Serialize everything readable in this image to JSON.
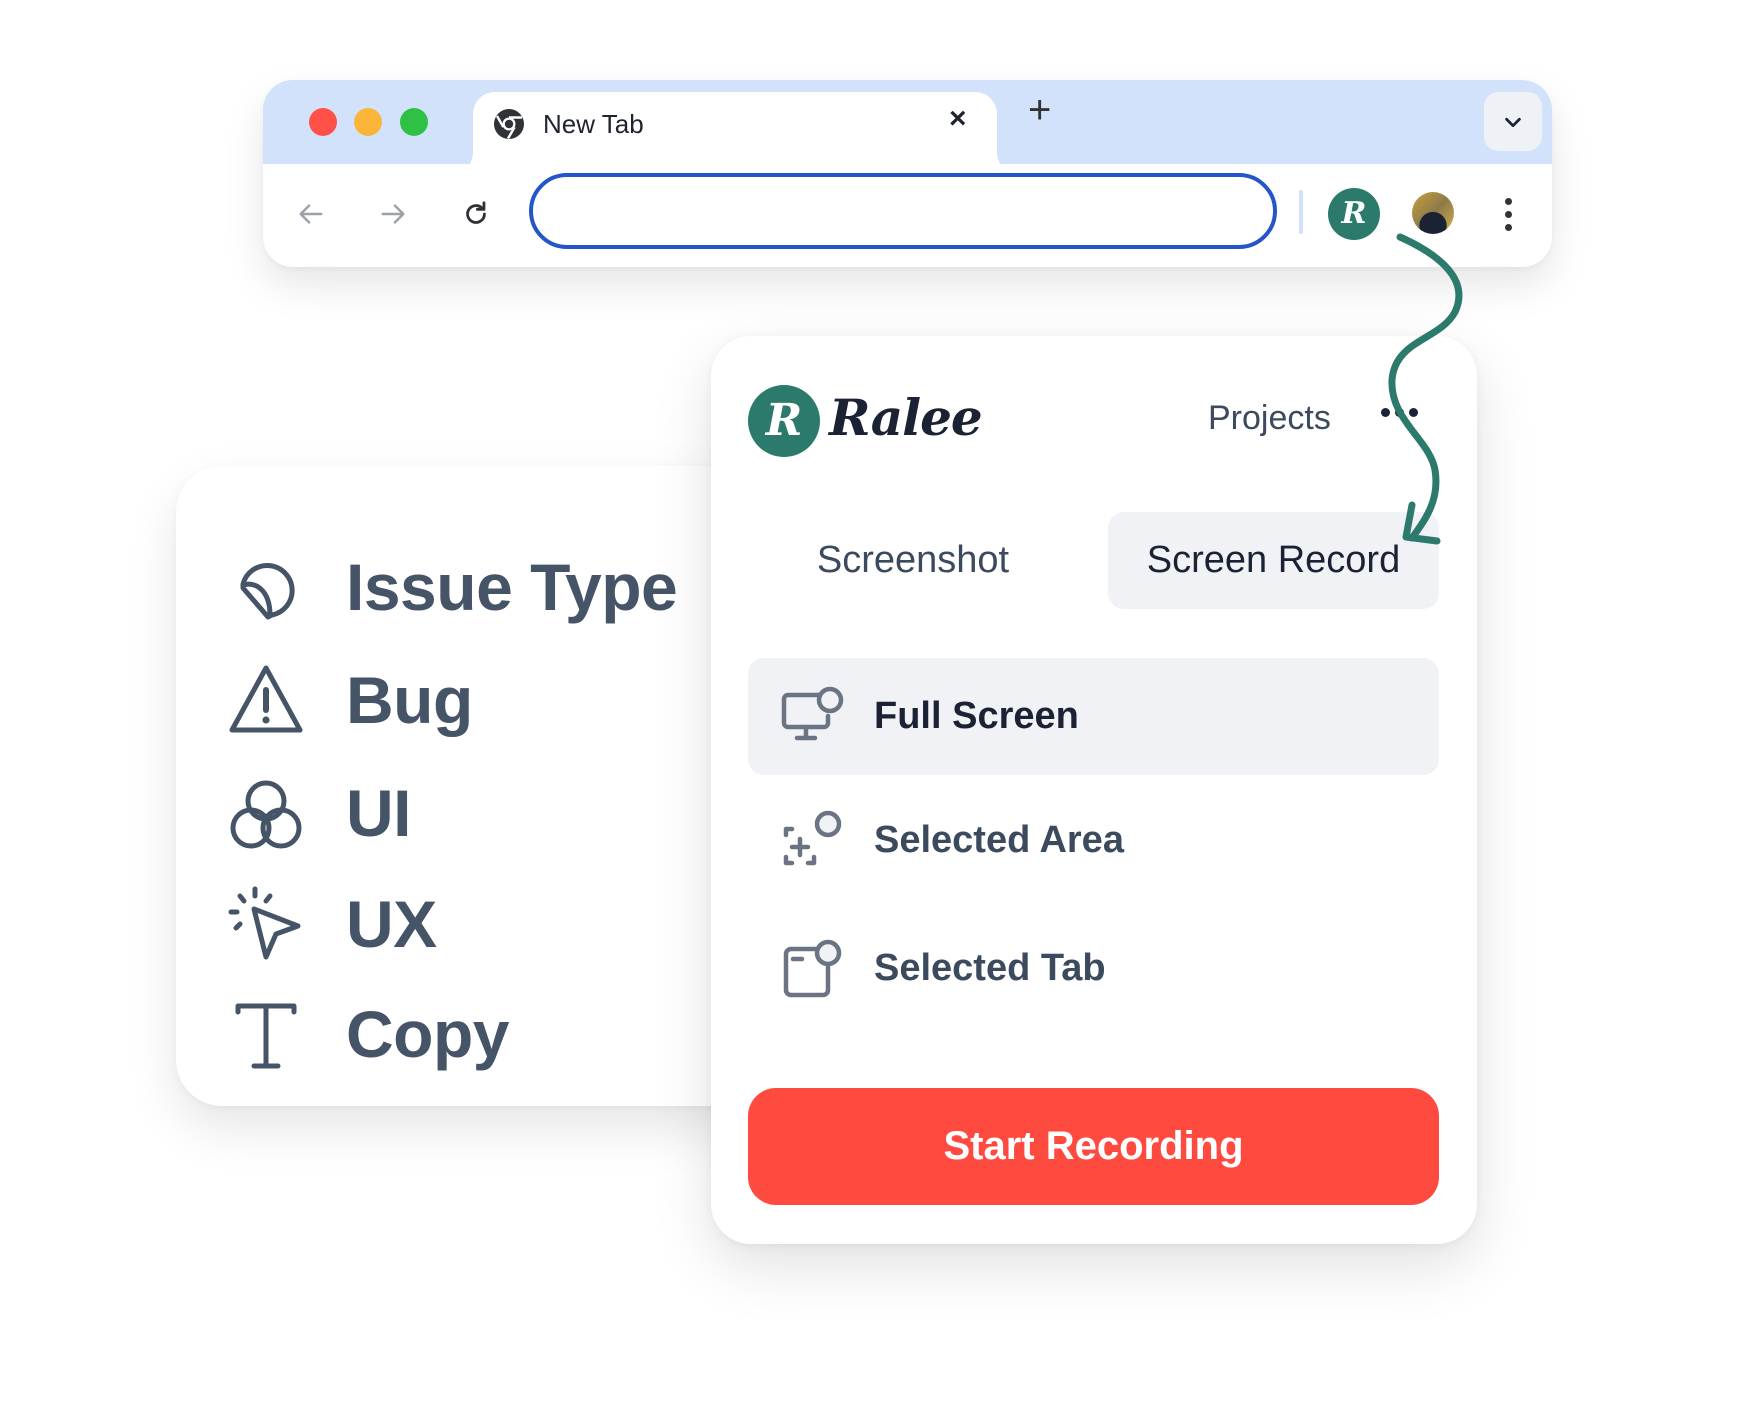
{
  "browser": {
    "window_controls": {
      "close_color": "#ff5147",
      "minimize_color": "#fbb53a",
      "maximize_color": "#2fc144"
    },
    "tab": {
      "title": "New Tab",
      "icon": "chrome-icon",
      "close_label": "×"
    },
    "new_tab_label": "+",
    "tab_strip_color": "#d3e2fb",
    "toolbar": {
      "back_icon": "arrow-left-icon",
      "forward_icon": "arrow-right-icon",
      "reload_icon": "reload-icon",
      "address_value": "",
      "address_placeholder": "",
      "address_focus_color": "#2456c9",
      "extension_letter": "R",
      "extension_color": "#2c7a6b",
      "menu_icon": "kebab-icon"
    }
  },
  "issue_card": {
    "items": [
      {
        "label": "Issue Type",
        "icon": "sticker-icon"
      },
      {
        "label": "Bug",
        "icon": "warning-triangle-icon"
      },
      {
        "label": "UI",
        "icon": "circles-icon"
      },
      {
        "label": "UX",
        "icon": "pointer-click-icon"
      },
      {
        "label": "Copy",
        "icon": "text-icon"
      }
    ],
    "text_color": "#465467"
  },
  "popup": {
    "brand": {
      "logo_letter": "R",
      "name": "Ralee",
      "color": "#2c7a6b"
    },
    "projects_label": "Projects",
    "more_icon": "more-horizontal-icon",
    "modes": [
      {
        "label": "Screenshot",
        "active": false
      },
      {
        "label": "Screen Record",
        "active": true
      }
    ],
    "options": [
      {
        "label": "Full Screen",
        "icon": "monitor-icon",
        "selected": true
      },
      {
        "label": "Selected Area",
        "icon": "selection-icon",
        "selected": false
      },
      {
        "label": "Selected Tab",
        "icon": "window-tab-icon",
        "selected": false
      }
    ],
    "start_button_label": "Start Recording",
    "start_button_color": "#ff4a3f"
  }
}
